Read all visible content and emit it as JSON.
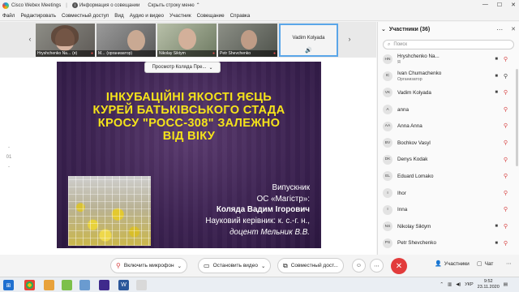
{
  "app": {
    "title": "Cisco Webex Meetings",
    "info_label": "Информация о совещании",
    "hide_menu_label": "Скрыть строку меню",
    "window_controls": [
      "—",
      "☐",
      "✕"
    ]
  },
  "menu": [
    "Файл",
    "Редактировать",
    "Совместный доступ",
    "Вид",
    "Аудио и видео",
    "Участник",
    "Совещание",
    "Справка"
  ],
  "thumbnails": [
    {
      "name": "Hryshchenko Na...",
      "tag": "(я)"
    },
    {
      "name": "M...",
      "tag": "(организатор)"
    },
    {
      "name": "Nikolay Siktym",
      "tag": ""
    },
    {
      "name": "Petr Shevchenko",
      "tag": ""
    },
    {
      "name": "Vadim Kolyada",
      "tag": ""
    }
  ],
  "viewer_tab": "Просмотр Коляда Пре...",
  "zoom_tools": [
    "-",
    "01",
    "-"
  ],
  "slide": {
    "title_lines": [
      "ІНКУБАЦІЙНІ ЯКОСТІ ЯЄЦЬ",
      "КУРЕЙ БАТЬКІВСЬКОГО СТАДА",
      "КРОСУ \"РОСС-308\"  ЗАЛЕЖНО",
      "ВІД ВІКУ"
    ],
    "text": {
      "line1": "Випускник",
      "line2": "ОС «Магістр»:",
      "line3": "Коляда Вадим Ігорович",
      "line4": "Науковий керівник: к. с.-г. н.,",
      "line5": "доцент Мельник В.В."
    }
  },
  "controls": {
    "mic": "Включить микрофон",
    "video": "Остановить видео",
    "share": "Совместный дост...",
    "participants": "Участники",
    "chat": "Чат"
  },
  "panel": {
    "title": "Участники (36)",
    "search_placeholder": "Поиск",
    "participants": [
      {
        "initials": "HN",
        "name": "Hryshchenko Na...",
        "role": "Я",
        "cam": "cam",
        "mic": "muted"
      },
      {
        "initials": "IC",
        "name": "Ivan Chumachenko",
        "role": "Организатор",
        "cam": "cam",
        "mic": "on"
      },
      {
        "initials": "VK",
        "name": "Vadim Kolyada",
        "role": "",
        "cam": "cam",
        "mic": "muted"
      },
      {
        "initials": "A",
        "name": "anna",
        "role": "",
        "cam": "",
        "mic": "muted"
      },
      {
        "initials": "AA",
        "name": "Anna Anna",
        "role": "",
        "cam": "",
        "mic": "muted"
      },
      {
        "initials": "BV",
        "name": "Bochkov Vasyl",
        "role": "",
        "cam": "",
        "mic": "muted"
      },
      {
        "initials": "DK",
        "name": "Denys Kodak",
        "role": "",
        "cam": "",
        "mic": "muted"
      },
      {
        "initials": "EL",
        "name": "Eduard Lomako",
        "role": "",
        "cam": "",
        "mic": "muted"
      },
      {
        "initials": "I",
        "name": "Ihor",
        "role": "",
        "cam": "",
        "mic": "muted"
      },
      {
        "initials": "I",
        "name": "Inna",
        "role": "",
        "cam": "",
        "mic": "muted"
      },
      {
        "initials": "NS",
        "name": "Nikolay Siktym",
        "role": "",
        "cam": "cam",
        "mic": "muted"
      },
      {
        "initials": "PS",
        "name": "Petr Shevchenko",
        "role": "",
        "cam": "cam",
        "mic": "muted"
      }
    ]
  },
  "taskbar": {
    "lang": "УКР",
    "time": "9:52",
    "date": "23.11.2020"
  },
  "colors": {
    "accent": "#2a7bd5",
    "end_call": "#e23b3b",
    "slide_title": "#f5e31a",
    "slide_bg": "#3d2352"
  }
}
